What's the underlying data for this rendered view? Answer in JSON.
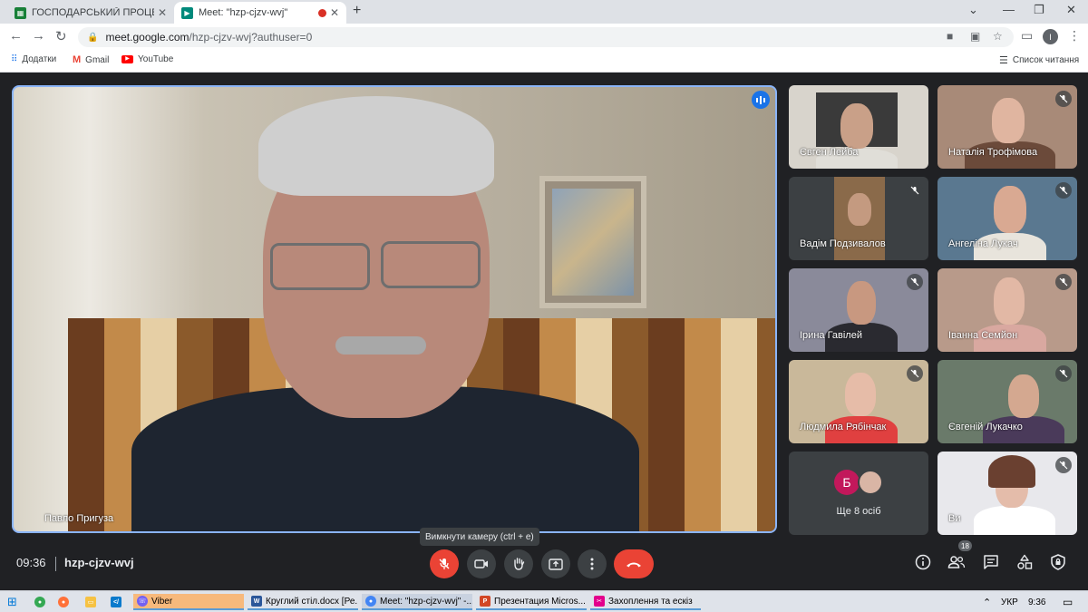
{
  "browser": {
    "tabs": [
      {
        "title": "ГОСПОДАРСЬКИЙ ПРОЦЕС Пр",
        "active": false
      },
      {
        "title": "Meet: \"hzp-cjzv-wvj\"",
        "active": true
      }
    ],
    "new_tab": "+",
    "address": {
      "host": "meet.google.com",
      "path": "/hzp-cjzv-wvj?authuser=0"
    },
    "profile_initial": "I",
    "bookmarks": [
      {
        "label": "Додатки"
      },
      {
        "label": "Gmail"
      },
      {
        "label": "YouTube"
      }
    ],
    "reading_list": "Список читання"
  },
  "meet": {
    "main_speaker": {
      "name": "Павло Пригуза"
    },
    "participants": [
      {
        "name": "Євген Лейба",
        "muted": false
      },
      {
        "name": "Наталія Трофімова",
        "muted": true
      },
      {
        "name": "Вадім Подзивалов",
        "muted": true
      },
      {
        "name": "Ангеліна Лукач",
        "muted": true
      },
      {
        "name": "Ірина Гавілей",
        "muted": true
      },
      {
        "name": "Іванна Семйон",
        "muted": true
      },
      {
        "name": "Людмила Рябінчак",
        "muted": true
      },
      {
        "name": "Євгеній Лукачко",
        "muted": true
      }
    ],
    "more_tile": {
      "initial": "Б",
      "label": "Ще 8 осіб"
    },
    "self_tile": {
      "name": "Ви",
      "muted": true
    },
    "time": "09:36",
    "code": "hzp-cjzv-wvj",
    "tooltip": "Вимкнути камеру (ctrl + e)",
    "people_count": "18"
  },
  "taskbar": {
    "apps": [
      {
        "label": "Viber"
      },
      {
        "label": "Круглий стіл.docx [Ре..."
      },
      {
        "label": "Meet: \"hzp-cjzv-wvj\" -..."
      },
      {
        "label": "Презентация Micros..."
      },
      {
        "label": "Захоплення та ескіз"
      }
    ],
    "lang": "УКР",
    "clock": "9:36"
  },
  "colors": {
    "accent": "#8ab4f8",
    "danger": "#ea4335",
    "surface": "#3c4043",
    "background": "#202124"
  }
}
